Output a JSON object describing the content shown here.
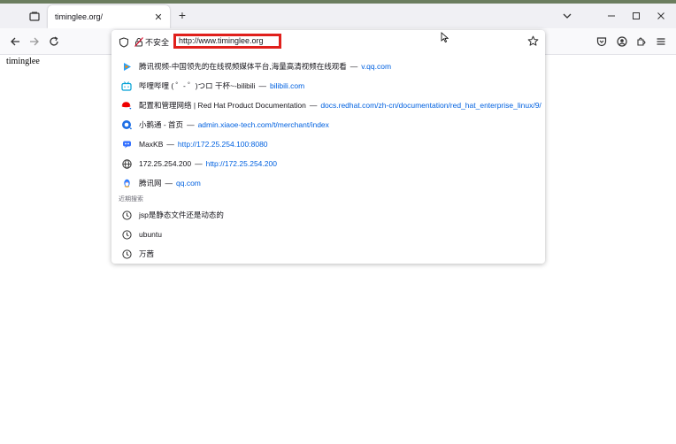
{
  "tab": {
    "title": "timinglee.org/"
  },
  "urlbar": {
    "security_label": "不安全",
    "url": "http://www.timinglee.org"
  },
  "page": {
    "body_text": "timinglee"
  },
  "suggestions": [
    {
      "icon": "tencent-video-icon",
      "title": "腾讯视频-中国领先的在线视频媒体平台,海量高清视频在线观看",
      "url": "v.qq.com"
    },
    {
      "icon": "bilibili-icon",
      "title": "哔哩哔哩 ( ゜- ゜)つロ 干杯~-bilibili",
      "url": "bilibili.com"
    },
    {
      "icon": "redhat-icon",
      "title": "配置和管理网络 | Red Hat Product Documentation",
      "url": "docs.redhat.com/zh-cn/documentation/red_hat_enterprise_linux/9/"
    },
    {
      "icon": "xiaoetong-icon",
      "title": "小鹅通 - 首页",
      "url": "admin.xiaoe-tech.com/t/merchant/index"
    },
    {
      "icon": "maxkb-icon",
      "title": "MaxKB",
      "url": "http://172.25.254.100:8080"
    },
    {
      "icon": "globe-icon",
      "title": "172.25.254.200",
      "url": "http://172.25.254.200"
    },
    {
      "icon": "qq-icon",
      "title": "腾讯网",
      "url": "qq.com"
    }
  ],
  "recent_searches": {
    "label": "近期搜索",
    "items": [
      "jsp是静态文件还是动态的",
      "ubuntu",
      "万茜"
    ]
  },
  "separator": "—"
}
